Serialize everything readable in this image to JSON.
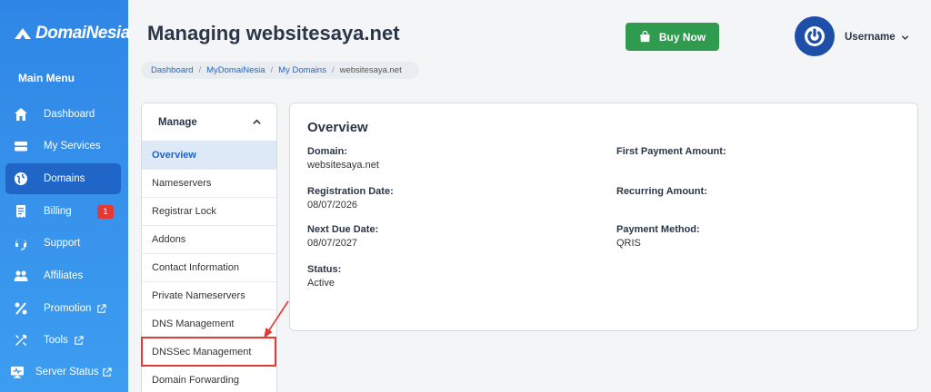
{
  "brand": {
    "name": "DomaiNesia"
  },
  "sidebar": {
    "menu_title": "Main Menu",
    "items": [
      {
        "label": "Dashboard",
        "icon": "home-icon"
      },
      {
        "label": "My Services",
        "icon": "server-icon"
      },
      {
        "label": "Domains",
        "icon": "globe-icon",
        "active": true
      },
      {
        "label": "Billing",
        "icon": "receipt-icon",
        "badge": "1"
      },
      {
        "label": "Support",
        "icon": "headset-icon"
      },
      {
        "label": "Affiliates",
        "icon": "users-icon"
      },
      {
        "label": "Promotion",
        "icon": "percent-icon",
        "external": true
      },
      {
        "label": "Tools",
        "icon": "tools-icon",
        "external": true
      },
      {
        "label": "Server Status",
        "icon": "monitor-icon",
        "external": true
      }
    ]
  },
  "header": {
    "title": "Managing websitesaya.net",
    "buy_label": "Buy Now",
    "username": "Username"
  },
  "breadcrumb": [
    "Dashboard",
    "MyDomaiNesia",
    "My Domains",
    "websitesaya.net"
  ],
  "manage": {
    "title": "Manage",
    "items": [
      "Overview",
      "Nameservers",
      "Registrar Lock",
      "Addons",
      "Contact Information",
      "Private Nameservers",
      "DNS Management",
      "DNSSec Management",
      "Domain Forwarding"
    ]
  },
  "overview": {
    "title": "Overview",
    "domain_label": "Domain:",
    "domain_value": "websitesaya.net",
    "reg_label": "Registration Date:",
    "reg_value": "08/07/2026",
    "due_label": "Next Due Date:",
    "due_value": "08/07/2027",
    "status_label": "Status:",
    "status_value": "Active",
    "first_label": "First Payment Amount:",
    "first_value": "",
    "recurring_label": "Recurring Amount:",
    "recurring_value": "",
    "method_label": "Payment Method:",
    "method_value": "QRIS"
  },
  "colors": {
    "sidebar": "#3a94ec",
    "active_nav": "#1f66c8",
    "buy_button": "#2e9b4f",
    "highlight": "#e53935"
  }
}
